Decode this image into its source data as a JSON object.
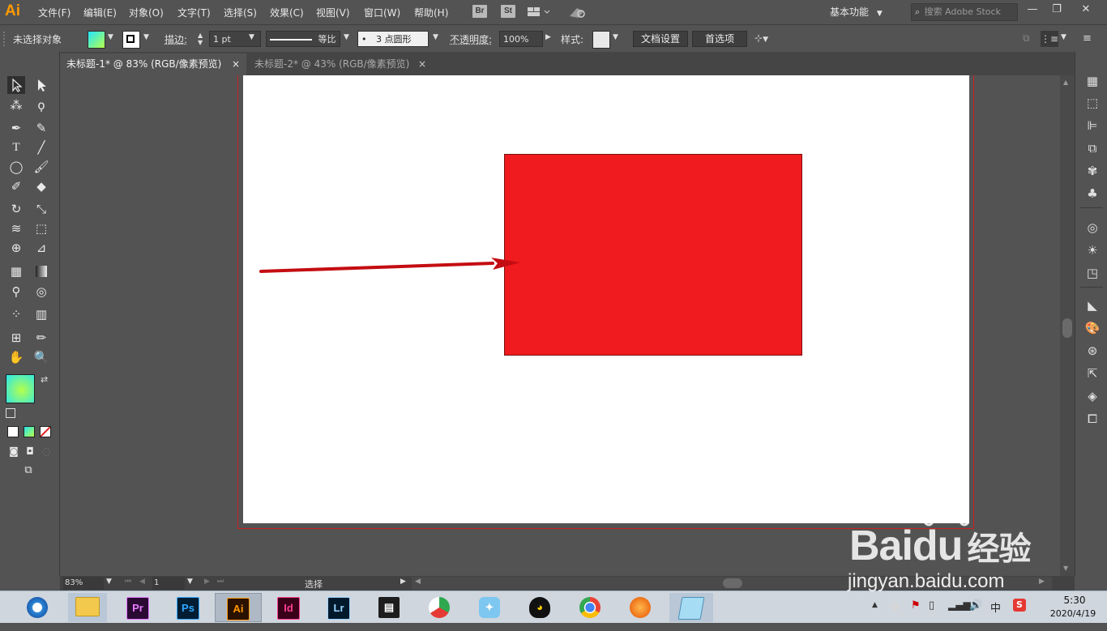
{
  "app": {
    "logo": "Ai"
  },
  "menu": [
    "文件(F)",
    "编辑(E)",
    "对象(O)",
    "文字(T)",
    "选择(S)",
    "效果(C)",
    "视图(V)",
    "窗口(W)",
    "帮助(H)"
  ],
  "bridge": {
    "br": "Br",
    "st": "St"
  },
  "workspace": "基本功能",
  "search": {
    "placeholder": "搜索 Adobe Stock"
  },
  "control": {
    "selection_label": "未选择对象",
    "stroke_label": "描边",
    "stroke_value": "1 pt",
    "profile_label": "等比",
    "brush_label": "3 点圆形",
    "brush_dot": "•",
    "opacity_label": "不透明度",
    "opacity_value": "100%",
    "style_label": "样式",
    "doc_setup": "文档设置",
    "preferences": "首选项"
  },
  "tabs": [
    {
      "title": "未标题-1* @ 83% (RGB/像素预览)",
      "close": "×",
      "active": true
    },
    {
      "title": "未标题-2* @ 43% (RGB/像素预览)",
      "close": "×",
      "active": false
    }
  ],
  "colors": {
    "fill_rect": "#ef1b1e",
    "ui_bg": "#535353",
    "logo": "#ff9a00"
  },
  "status": {
    "zoom": "83%",
    "artboard": "1",
    "tool": "选择"
  },
  "taskbar": {
    "apps": [
      {
        "name": "browser",
        "label": ""
      },
      {
        "name": "explorer",
        "label": ""
      },
      {
        "name": "premiere",
        "label": "Pr"
      },
      {
        "name": "photoshop",
        "label": "Ps"
      },
      {
        "name": "illustrator",
        "label": "Ai"
      },
      {
        "name": "indesign",
        "label": "Id"
      },
      {
        "name": "lightroom",
        "label": "Lr"
      },
      {
        "name": "video",
        "label": ""
      },
      {
        "name": "green-app",
        "label": ""
      },
      {
        "name": "bird-app",
        "label": ""
      },
      {
        "name": "qq",
        "label": ""
      },
      {
        "name": "chrome",
        "label": ""
      },
      {
        "name": "orange-app",
        "label": ""
      },
      {
        "name": "notes",
        "label": ""
      }
    ],
    "tray_ime": "中",
    "time": "5:30",
    "date": "2020/4/19"
  },
  "watermark": {
    "brand": "Bai",
    "brand2": "du",
    "cn": "经验",
    "url": "jingyan.baidu.com"
  }
}
